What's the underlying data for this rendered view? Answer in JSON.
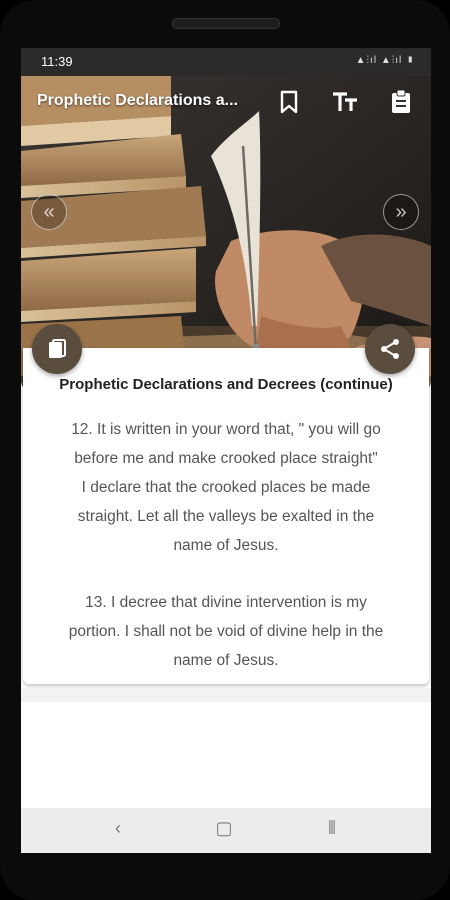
{
  "status_bar": {
    "time": "11:39",
    "indicators": "▲⫶ıl ▲⫶ıl ▮"
  },
  "toolbar": {
    "title": "Prophetic Declarations a...",
    "icons": [
      "bookmark-icon",
      "text-size-icon",
      "clipboard-icon"
    ]
  },
  "hero": {
    "prev_glyph": "«",
    "next_glyph": "»"
  },
  "article": {
    "heading": "Prophetic Declarations and Decrees (continue)",
    "paragraph_1": [
      "12. It is written in your word that, \" you will go",
      "before me and make crooked place straight\"",
      "I declare that the crooked places be made",
      "straight. Let all the valleys be exalted in the",
      "name of Jesus."
    ],
    "paragraph_2": [
      "13. I decree that divine intervention is my",
      "portion. I shall not be void of divine help in the",
      "name of Jesus."
    ]
  },
  "nav": {
    "back": "‹",
    "home": "▢",
    "recents": "⦀"
  },
  "colors": {
    "fab": "#5b4d3e",
    "status_bar": "#2a2a2a",
    "text": "#555555"
  }
}
